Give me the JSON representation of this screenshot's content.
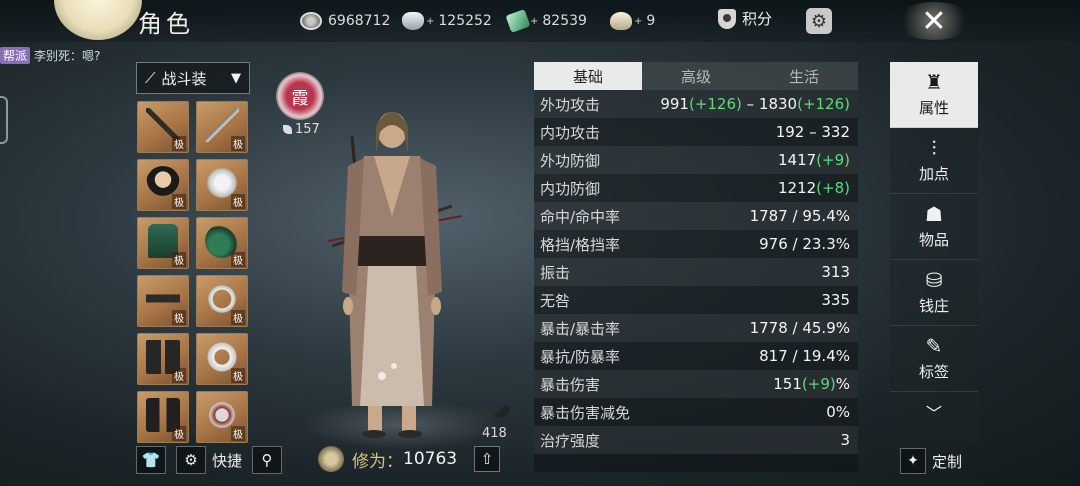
{
  "header": {
    "title": "角色",
    "resources": [
      {
        "icon": "copper-coin-icon",
        "value": "6968712",
        "add": false
      },
      {
        "icon": "silver-tael-icon",
        "value": "125252",
        "add": true
      },
      {
        "icon": "jade-ticket-icon",
        "value": "82539",
        "add": true
      },
      {
        "icon": "gold-ingot-icon",
        "value": "9",
        "add": true
      }
    ],
    "score_label": "积分",
    "close_symbol": "✕"
  },
  "chat": {
    "channel": "帮派",
    "message": "李别死：嗯?"
  },
  "equipment": {
    "outfit_label": "战斗装",
    "tier_label": "极",
    "slots": [
      {
        "name": "weapon",
        "art": "weapon"
      },
      {
        "name": "secondary-weapon",
        "art": "blade"
      },
      {
        "name": "head",
        "art": "head"
      },
      {
        "name": "accessory",
        "art": "flower"
      },
      {
        "name": "chest",
        "art": "robe"
      },
      {
        "name": "gourd",
        "art": "gourd"
      },
      {
        "name": "belt",
        "art": "belt"
      },
      {
        "name": "bracelet",
        "art": "bangle"
      },
      {
        "name": "pants",
        "art": "pants"
      },
      {
        "name": "ring",
        "art": "ring"
      },
      {
        "name": "boots",
        "art": "boots"
      },
      {
        "name": "pendant",
        "art": "pendant"
      }
    ],
    "quick_label": "快捷"
  },
  "character": {
    "sect_badge": "霞",
    "sect_level": "157",
    "pet_count": "418",
    "cultivation_label": "修为：",
    "cultivation_value": "10763"
  },
  "stats": {
    "tabs": [
      {
        "label": "基础",
        "active": true
      },
      {
        "label": "高级",
        "active": false
      },
      {
        "label": "生活",
        "active": false
      }
    ],
    "rows": [
      {
        "name": "外功攻击",
        "parts": [
          {
            "t": "991",
            "c": ""
          },
          {
            "t": "(+126)",
            "c": "green"
          },
          {
            "t": " – 1830",
            "c": ""
          },
          {
            "t": "(+126)",
            "c": "green"
          }
        ]
      },
      {
        "name": "内功攻击",
        "parts": [
          {
            "t": "192 – 332",
            "c": ""
          }
        ]
      },
      {
        "name": "外功防御",
        "parts": [
          {
            "t": "1417",
            "c": ""
          },
          {
            "t": "(+9)",
            "c": "green"
          }
        ]
      },
      {
        "name": "内功防御",
        "parts": [
          {
            "t": "1212",
            "c": ""
          },
          {
            "t": "(+8)",
            "c": "green"
          }
        ]
      },
      {
        "name": "命中/命中率",
        "parts": [
          {
            "t": "1787 / 95.4%",
            "c": ""
          }
        ]
      },
      {
        "name": "格挡/格挡率",
        "parts": [
          {
            "t": "976 / 23.3%",
            "c": ""
          }
        ]
      },
      {
        "name": "振击",
        "parts": [
          {
            "t": "313",
            "c": ""
          }
        ]
      },
      {
        "name": "无咎",
        "parts": [
          {
            "t": "335",
            "c": ""
          }
        ]
      },
      {
        "name": "暴击/暴击率",
        "parts": [
          {
            "t": "1778 / 45.9%",
            "c": ""
          }
        ]
      },
      {
        "name": "暴抗/防暴率",
        "parts": [
          {
            "t": "817 / 19.4%",
            "c": ""
          }
        ]
      },
      {
        "name": "暴击伤害",
        "parts": [
          {
            "t": "151",
            "c": ""
          },
          {
            "t": "(+9)",
            "c": "green"
          },
          {
            "t": "%",
            "c": ""
          }
        ]
      },
      {
        "name": "暴击伤害减免",
        "parts": [
          {
            "t": "0%",
            "c": ""
          }
        ]
      },
      {
        "name": "治疗强度",
        "parts": [
          {
            "t": "3",
            "c": ""
          }
        ]
      }
    ]
  },
  "side_menu": {
    "items": [
      {
        "label": "属性",
        "icon": "helmet-icon",
        "glyph": "♜",
        "active": true
      },
      {
        "label": "加点",
        "icon": "sliders-icon",
        "glyph": "⫶",
        "active": false
      },
      {
        "label": "物品",
        "icon": "bag-icon",
        "glyph": "☗",
        "active": false
      },
      {
        "label": "钱庄",
        "icon": "bank-icon",
        "glyph": "⛁",
        "active": false
      },
      {
        "label": "标签",
        "icon": "tag-icon",
        "glyph": "✎",
        "active": false
      }
    ],
    "more_glyph": "﹀",
    "customize_label": "定制"
  }
}
